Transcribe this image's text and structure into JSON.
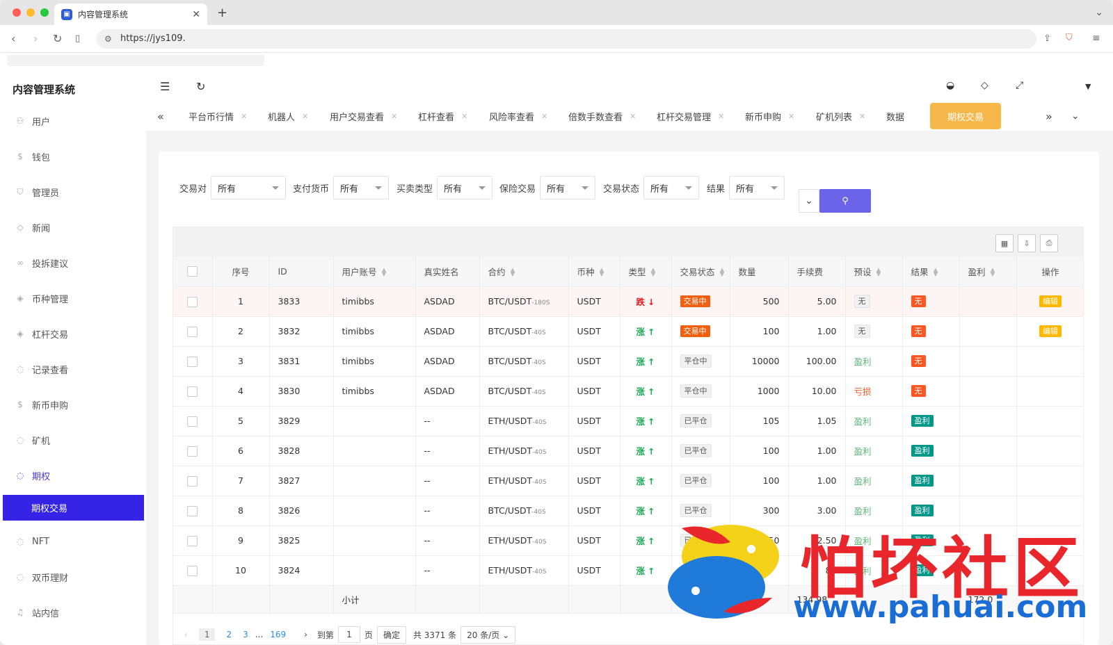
{
  "browser": {
    "tab_title": "内容管理系统",
    "url": "https://jys109."
  },
  "app": {
    "brand": "内容管理系统"
  },
  "sidebar": {
    "items": [
      {
        "label": "用户",
        "icon": "user-icon"
      },
      {
        "label": "钱包",
        "icon": "wallet-icon"
      },
      {
        "label": "管理员",
        "icon": "shield-icon"
      },
      {
        "label": "新闻",
        "icon": "tag-icon"
      },
      {
        "label": "投拆建议",
        "icon": "link-icon"
      },
      {
        "label": "币种管理",
        "icon": "diamond-icon"
      },
      {
        "label": "杠杆交易",
        "icon": "diamond-icon"
      },
      {
        "label": "记录查看",
        "icon": "circle-icon"
      },
      {
        "label": "新币申购",
        "icon": "coin-icon"
      },
      {
        "label": "矿机",
        "icon": "circle-icon"
      },
      {
        "label": "期权",
        "icon": "circle-icon"
      }
    ],
    "active_sub": "期权交易",
    "items_after": [
      {
        "label": "NFT",
        "icon": "circle-icon"
      },
      {
        "label": "双币理财",
        "icon": "circle-icon"
      },
      {
        "label": "站内信",
        "icon": "bell-icon"
      }
    ]
  },
  "tabs": [
    "平台币行情",
    "机器人",
    "用户交易查看",
    "杠杆查看",
    "风险率查看",
    "倍数手数查看",
    "杠杆交易管理",
    "新币申购",
    "矿机列表",
    "数据",
    "期权交易"
  ],
  "filters": [
    {
      "label": "交易对",
      "value": "所有"
    },
    {
      "label": "支付货币",
      "value": "所有"
    },
    {
      "label": "买卖类型",
      "value": "所有"
    },
    {
      "label": "保险交易",
      "value": "所有"
    },
    {
      "label": "交易状态",
      "value": "所有"
    },
    {
      "label": "结果",
      "value": "所有"
    }
  ],
  "table": {
    "headers": [
      "序号",
      "ID",
      "用户账号",
      "真实姓名",
      "合约",
      "币种",
      "类型",
      "交易状态",
      "数量",
      "手续费",
      "预设",
      "结果",
      "盈利",
      "操作"
    ],
    "rows": [
      {
        "no": "1",
        "id": "3833",
        "user": "timibbs",
        "name": "ASDAD",
        "pair": "BTC/USDT",
        "period": "-180S",
        "coin": "USDT",
        "type": "跌",
        "dir": "down",
        "status": "交易中",
        "qty": "500",
        "fee": "5.00",
        "preset": "无",
        "result": "无",
        "action": "编辑"
      },
      {
        "no": "2",
        "id": "3832",
        "user": "timibbs",
        "name": "ASDAD",
        "pair": "BTC/USDT",
        "period": "-40S",
        "coin": "USDT",
        "type": "涨",
        "dir": "up",
        "status": "交易中",
        "qty": "100",
        "fee": "1.00",
        "preset": "无",
        "result": "无",
        "action": "编辑"
      },
      {
        "no": "3",
        "id": "3831",
        "user": "timibbs",
        "name": "ASDAD",
        "pair": "BTC/USDT",
        "period": "-40S",
        "coin": "USDT",
        "type": "涨",
        "dir": "up",
        "status": "平仓中",
        "qty": "10000",
        "fee": "100.00",
        "preset": "盈利",
        "result": "无",
        "action": ""
      },
      {
        "no": "4",
        "id": "3830",
        "user": "timibbs",
        "name": "ASDAD",
        "pair": "BTC/USDT",
        "period": "-40S",
        "coin": "USDT",
        "type": "涨",
        "dir": "up",
        "status": "平仓中",
        "qty": "1000",
        "fee": "10.00",
        "preset": "亏损",
        "result": "无",
        "action": ""
      },
      {
        "no": "5",
        "id": "3829",
        "user": "",
        "name": "--",
        "pair": "ETH/USDT",
        "period": "-40S",
        "coin": "USDT",
        "type": "涨",
        "dir": "up",
        "status": "已平仓",
        "qty": "105",
        "fee": "1.05",
        "preset": "盈利",
        "result": "盈利",
        "action": ""
      },
      {
        "no": "6",
        "id": "3828",
        "user": "",
        "name": "--",
        "pair": "ETH/USDT",
        "period": "-40S",
        "coin": "USDT",
        "type": "涨",
        "dir": "up",
        "status": "已平仓",
        "qty": "100",
        "fee": "1.00",
        "preset": "盈利",
        "result": "盈利",
        "action": ""
      },
      {
        "no": "7",
        "id": "3827",
        "user": "",
        "name": "--",
        "pair": "ETH/USDT",
        "period": "-40S",
        "coin": "USDT",
        "type": "涨",
        "dir": "up",
        "status": "已平仓",
        "qty": "100",
        "fee": "1.00",
        "preset": "盈利",
        "result": "盈利",
        "action": ""
      },
      {
        "no": "8",
        "id": "3826",
        "user": "",
        "name": "--",
        "pair": "BTC/USDT",
        "period": "-40S",
        "coin": "USDT",
        "type": "涨",
        "dir": "up",
        "status": "已平仓",
        "qty": "300",
        "fee": "3.00",
        "preset": "盈利",
        "result": "盈利",
        "action": ""
      },
      {
        "no": "9",
        "id": "3825",
        "user": "",
        "name": "--",
        "pair": "ETH/USDT",
        "period": "-40S",
        "coin": "USDT",
        "type": "涨",
        "dir": "up",
        "status": "已平仓",
        "qty": "250",
        "fee": "2.50",
        "preset": "盈利",
        "result": "盈利",
        "action": ""
      },
      {
        "no": "10",
        "id": "3824",
        "user": "",
        "name": "--",
        "pair": "ETH/USDT",
        "period": "-40S",
        "coin": "USDT",
        "type": "涨",
        "dir": "up",
        "status": "",
        "qty": "",
        "fee": "80",
        "preset": "盈利",
        "result": "盈利",
        "action": ""
      }
    ],
    "subtotal_label": "小计",
    "subtotal_fee": "134.98",
    "subtotal_profit": "172.0"
  },
  "pager": {
    "pages": [
      "1",
      "2",
      "3",
      "...",
      "169"
    ],
    "goto": "到第",
    "page_input": "1",
    "page_unit": "页",
    "ok": "确定",
    "total": "共 3371 条",
    "per_page": "20 条/页"
  },
  "watermark": {
    "text": "怕坏社区",
    "url": "www.pahuai.com"
  }
}
